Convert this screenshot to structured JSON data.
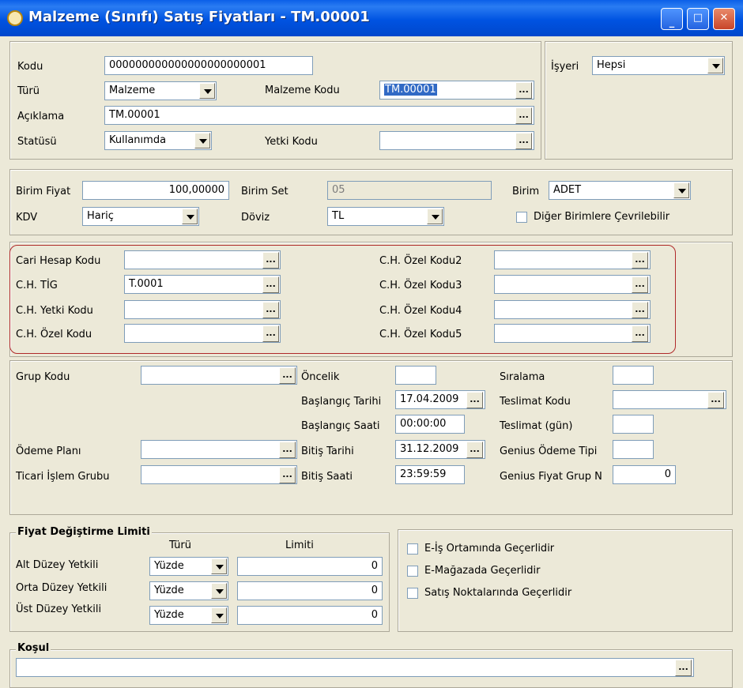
{
  "window": {
    "title": "Malzeme (Sınıfı) Satış Fiyatları - TM.00001"
  },
  "general": {
    "kodu_label": "Kodu",
    "kodu_value": "000000000000000000000001",
    "turu_label": "Türü",
    "turu_value": "Malzeme",
    "malzeme_kodu_label": "Malzeme Kodu",
    "malzeme_kodu_value": "TM.00001",
    "aciklama_label": "Açıklama",
    "aciklama_value": "TM.00001",
    "statusu_label": "Statüsü",
    "statusu_value": "Kullanımda",
    "yetki_kodu_label": "Yetki Kodu",
    "yetki_kodu_value": "",
    "isyeri_label": "İşyeri",
    "isyeri_value": "Hepsi"
  },
  "price": {
    "birim_fiyat_label": "Birim Fiyat",
    "birim_fiyat_value": "100,00000",
    "birim_set_label": "Birim Set",
    "birim_set_value": "05",
    "birim_label": "Birim",
    "birim_value": "ADET",
    "kdv_label": "KDV",
    "kdv_value": "Hariç",
    "doviz_label": "Döviz",
    "doviz_value": "TL",
    "convert_label": "Diğer Birimlere Çevrilebilir"
  },
  "account": {
    "cari_label": "Cari Hesap Kodu",
    "cari_value": "",
    "tig_label": "C.H. TİG",
    "tig_value": "T.0001",
    "yetki_label": "C.H. Yetki Kodu",
    "yetki_value": "",
    "ozel_label": "C.H. Özel Kodu",
    "ozel_value": "",
    "ozel2_label": "C.H. Özel Kodu2",
    "ozel3_label": "C.H. Özel Kodu3",
    "ozel4_label": "C.H. Özel Kodu4",
    "ozel5_label": "C.H. Özel Kodu5"
  },
  "details": {
    "grup_label": "Grup Kodu",
    "odeme_label": "Ödeme Planı",
    "ticari_label": "Ticari İşlem Grubu",
    "oncelik_label": "Öncelik",
    "oncelik_value": "",
    "bas_tarih_label": "Başlangıç Tarihi",
    "bas_tarih_value": "17.04.2009",
    "bas_saat_label": "Başlangıç Saati",
    "bas_saat_value": "00:00:00",
    "bit_tarih_label": "Bitiş Tarihi",
    "bit_tarih_value": "31.12.2009",
    "bit_saat_label": "Bitiş Saati",
    "bit_saat_value": "23:59:59",
    "siralama_label": "Sıralama",
    "teslimat_kodu_label": "Teslimat Kodu",
    "teslimat_gun_label": "Teslimat (gün)",
    "genius_odeme_label": "Genius Ödeme Tipi",
    "genius_fiyat_label": "Genius Fiyat Grup N",
    "genius_fiyat_value": "0"
  },
  "limits": {
    "title": "Fiyat Değiştirme Limiti",
    "col_turu": "Türü",
    "col_limit": "Limiti",
    "rows": [
      {
        "label": "Alt Düzey Yetkili",
        "type": "Yüzde",
        "value": "0"
      },
      {
        "label": "Orta Düzey Yetkili",
        "type": "Yüzde",
        "value": "0"
      },
      {
        "label": "Üst Düzey Yetkili",
        "type": "Yüzde",
        "value": "0"
      }
    ]
  },
  "validity": {
    "eis": "E-İş Ortamında Geçerlidir",
    "emagaza": "E-Mağazada Geçerlidir",
    "satis": "Satış Noktalarında Geçerlidir"
  },
  "kosul": {
    "title": "Koşul",
    "value": ""
  },
  "icons": {
    "lookup_button": "ellipsis",
    "dropdown_button": "chevron-down"
  },
  "colors": {
    "titlebar": "#0053e1",
    "highlight_box": "#b02a2a",
    "selection": "#316ac5"
  }
}
